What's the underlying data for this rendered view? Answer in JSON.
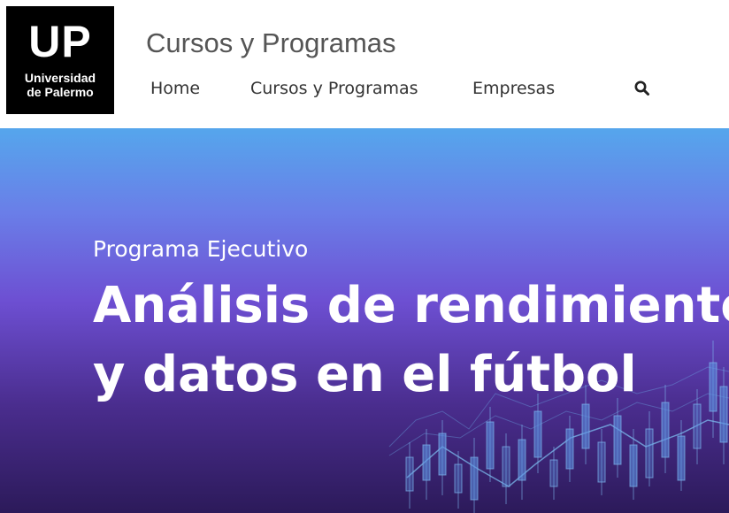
{
  "header": {
    "logo": {
      "mark": "UP",
      "line1": "Universidad",
      "line2": "de Palermo"
    },
    "site_title": "Cursos y Programas",
    "nav": {
      "items": [
        {
          "label": "Home"
        },
        {
          "label": "Cursos y Programas"
        },
        {
          "label": "Empresas"
        }
      ],
      "search_icon": "search-icon"
    }
  },
  "hero": {
    "kicker": "Programa Ejecutivo",
    "title_line1": "Análisis de rendimiento",
    "title_line2": "y datos en el fútbol",
    "background_colors": [
      "#55a6ec",
      "#6d4fd2",
      "#2c1a5a"
    ],
    "decoration": "candlestick-chart-graphic"
  }
}
